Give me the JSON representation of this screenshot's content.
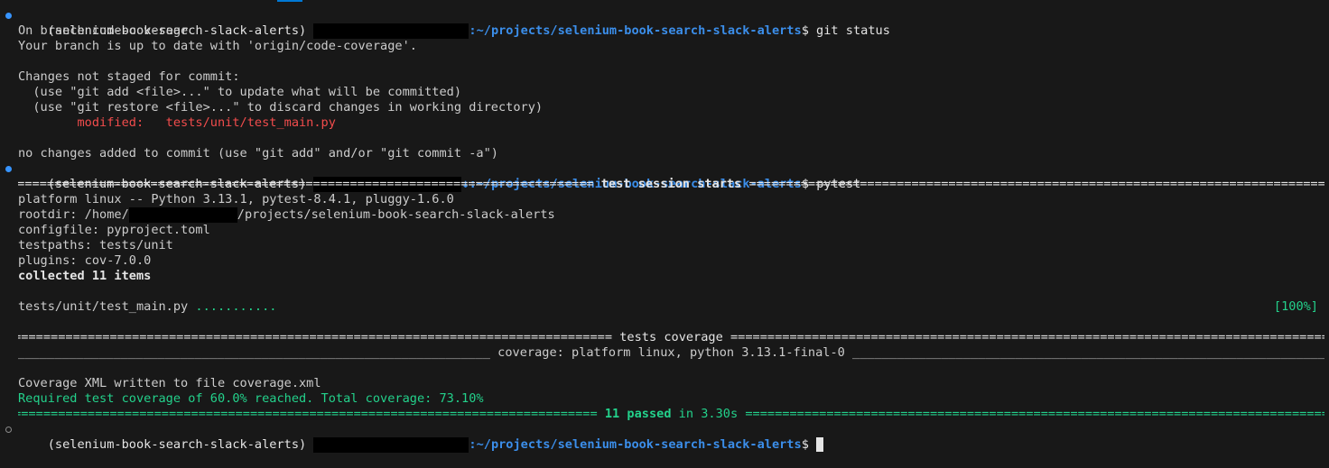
{
  "prompt": {
    "env": "(selenium-book-search-slack-alerts)",
    "path": ":~/projects/selenium-book-search-slack-alerts",
    "path_alt": "↓:~/projects/selenium-book-search-slack-alerts",
    "symbol": "$"
  },
  "cmd1": {
    "command": " git status",
    "output": [
      "On branch code-coverage",
      "Your branch is up to date with 'origin/code-coverage'.",
      "",
      "Changes not staged for commit:",
      "  (use \"git add <file>...\" to update what will be committed)",
      "  (use \"git restore <file>...\" to discard changes in working directory)"
    ],
    "modified_label": "        modified:   tests/unit/test_main.py",
    "footer": "no changes added to commit (use \"git add\" and/or \"git commit -a\")"
  },
  "cmd2": {
    "command": " pytest",
    "session_header": " test session starts ",
    "platform": "platform linux -- Python 3.13.1, pytest-8.4.1, pluggy-1.6.0",
    "rootdir_prefix": "rootdir: /home/",
    "rootdir_suffix": "/projects/selenium-book-search-slack-alerts",
    "configfile": "configfile: pyproject.toml",
    "testpaths": "testpaths: tests/unit",
    "plugins": "plugins: cov-7.0.0",
    "collected": "collected 11 items",
    "test_file": "tests/unit/test_main.py ",
    "test_dots": "...........",
    "test_percent": "[100%]",
    "coverage_header": " tests coverage ",
    "coverage_subheader": " coverage: platform linux, python 3.13.1-final-0 ",
    "coverage_xml": "Coverage XML written to file coverage.xml",
    "coverage_required": "Required test coverage of 60.0% reached. Total coverage: 73.10%",
    "summary_passed": " 11 passed",
    "summary_time": " in 3.30s "
  },
  "colors": {
    "background": "#181818",
    "prompt_path": "#3b8eea",
    "modified": "#f14c4c",
    "success": "#23d18b",
    "text": "#cccccc"
  }
}
